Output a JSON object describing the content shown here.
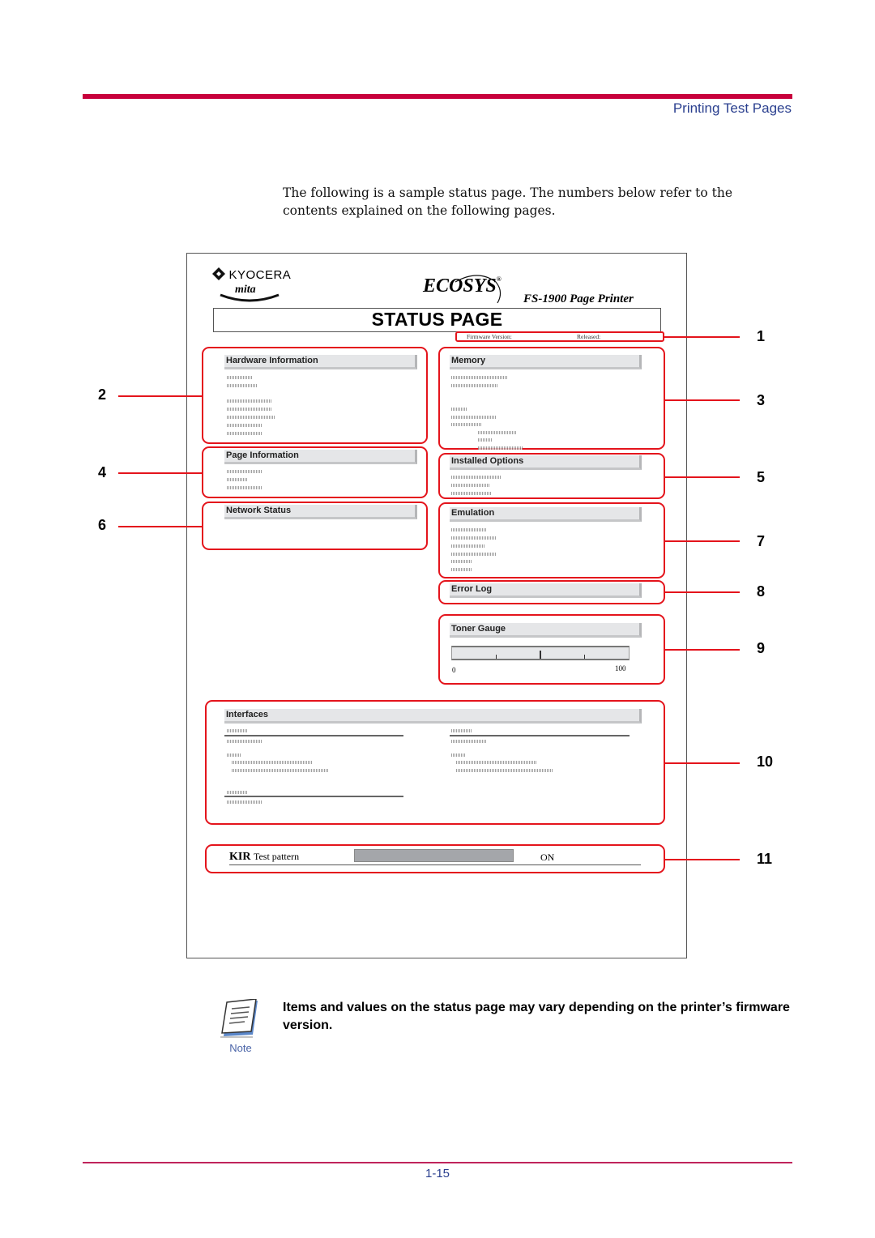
{
  "header": {
    "section_title": "Printing Test Pages",
    "accent_color": "#c8003c",
    "link_color": "#2a3f8f"
  },
  "intro": "The following is a sample status page. The numbers below refer to the contents explained on the following pages.",
  "sheet": {
    "brand": {
      "kyocera": "KYOCERA",
      "mita": "mita",
      "ecosys": "ECOSYS",
      "registered": "®"
    },
    "model": "FS-1900  Page Printer",
    "title": "STATUS PAGE",
    "firmware_label": "Firmware Version:",
    "released_label": "Released:",
    "sections": {
      "hardware": "Hardware Information",
      "memory": "Memory",
      "page_info": "Page Information",
      "installed_options": "Installed Options",
      "network": "Network Status",
      "emulation": "Emulation",
      "error_log": "Error Log",
      "toner": "Toner Gauge",
      "interfaces": "Interfaces"
    },
    "toner_gauge": {
      "min_label": "0",
      "max_label": "100"
    },
    "kir": {
      "label": "KIR",
      "sublabel": "Test pattern",
      "value": "ON"
    }
  },
  "callouts": [
    "1",
    "2",
    "3",
    "4",
    "5",
    "6",
    "7",
    "8",
    "9",
    "10",
    "11"
  ],
  "note": {
    "text": "Items and values on the status page may vary depending on the printer’s firmware version.",
    "label": "Note"
  },
  "footer": {
    "page_number": "1-15"
  }
}
